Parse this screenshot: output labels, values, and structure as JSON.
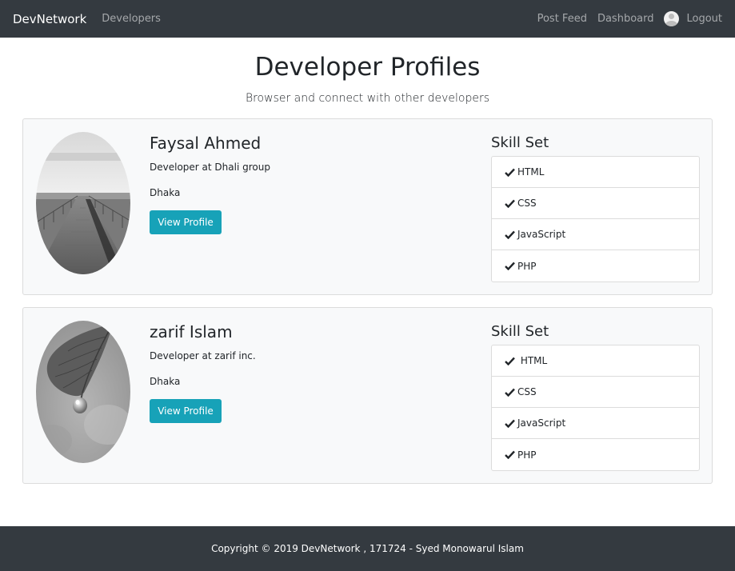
{
  "navbar": {
    "brand": "DevNetwork",
    "left_links": [
      "Developers"
    ],
    "right_links": {
      "post_feed": "Post Feed",
      "dashboard": "Dashboard",
      "logout": "Logout"
    }
  },
  "header": {
    "title": "Developer Profiles",
    "subtitle": "Browser and connect with other developers"
  },
  "profiles": [
    {
      "name": "Faysal Ahmed",
      "status": "Developer at Dhali group",
      "location": "Dhaka",
      "button_label": "View Profile",
      "skills_heading": "Skill Set",
      "skills": [
        "HTML",
        "CSS",
        "JavaScript",
        "PHP"
      ]
    },
    {
      "name": "zarif Islam",
      "status": "Developer at zarif inc.",
      "location": "Dhaka",
      "button_label": "View Profile",
      "skills_heading": "Skill Set",
      "skills": [
        " HTML",
        "CSS",
        "JavaScript",
        "PHP"
      ]
    }
  ],
  "footer": {
    "copyright": "Copyright © 2019 DevNetwork , 171724 - Syed Monowarul Islam"
  },
  "colors": {
    "navbar_bg": "#343a40",
    "button_bg": "#17a2b8",
    "card_bg": "#f8f9fa"
  },
  "icons": [
    "check-icon",
    "user-avatar-icon"
  ]
}
